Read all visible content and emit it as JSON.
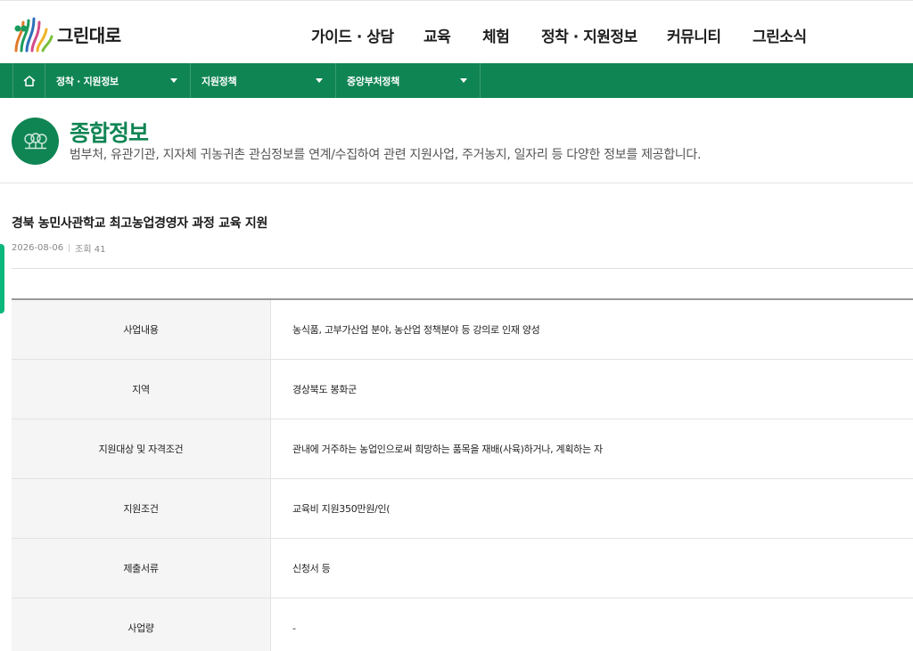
{
  "header": {
    "logo_text": "그린대로",
    "nav": [
      "가이드 · 상담",
      "교육",
      "체험",
      "정착 · 지원정보",
      "커뮤니티",
      "그린소식"
    ]
  },
  "subnav": {
    "home_icon": "home-icon",
    "crumbs": [
      "정착 · 지원정보",
      "지원정책",
      "중앙부처정책"
    ]
  },
  "hero": {
    "title": "종합정보",
    "desc": "범부처, 유관기관, 지자체 귀농귀촌 관심정보를 연계/수집하여 관련 지원사업, 주거농지, 일자리 등 다양한 정보를 제공합니다."
  },
  "post": {
    "title": "경북 농민사관학교 최고농업경영자 과정 교육 지원",
    "date": "2026-08-06",
    "views": "조회 41"
  },
  "table": [
    {
      "label": "사업내용",
      "value": "농식품, 고부가산업 분야, 농산업 정책분야 등 강의로 인재 양성"
    },
    {
      "label": "지역",
      "value": "경상북도 봉화군"
    },
    {
      "label": "지원대상 및 자격조건",
      "value": "관내에 거주하는 농업인으로써 희망하는 품목을 재배(사육)하거나, 계획하는 자"
    },
    {
      "label": "지원조건",
      "value": "교육비 지원350만원/인("
    },
    {
      "label": "제출서류",
      "value": "신청서 등"
    },
    {
      "label": "사업량",
      "value": "-"
    }
  ],
  "colors": {
    "brand": "#108554",
    "accent": "#0bb77a"
  }
}
